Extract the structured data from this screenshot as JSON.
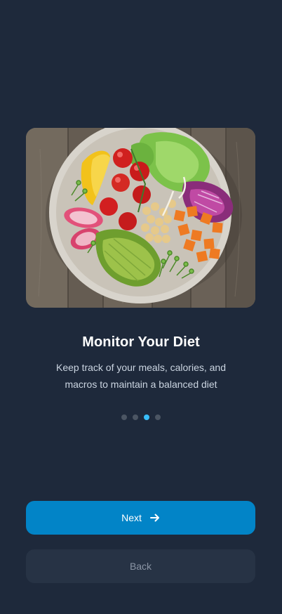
{
  "onboarding": {
    "image_alt": "Healthy salad bowl with vegetables",
    "title": "Monitor Your Diet",
    "description": "Keep track of your meals, calories, and macros to maintain a balanced diet",
    "pagination": {
      "total": 4,
      "active_index": 2
    }
  },
  "actions": {
    "next_label": "Next",
    "next_icon": "arrow-right-icon",
    "back_label": "Back"
  },
  "colors": {
    "background": "#1e293b",
    "primary": "#0284c7",
    "secondary_button": "#273345",
    "dot_active": "#38bdf8",
    "dot_inactive": "#4b5563"
  }
}
